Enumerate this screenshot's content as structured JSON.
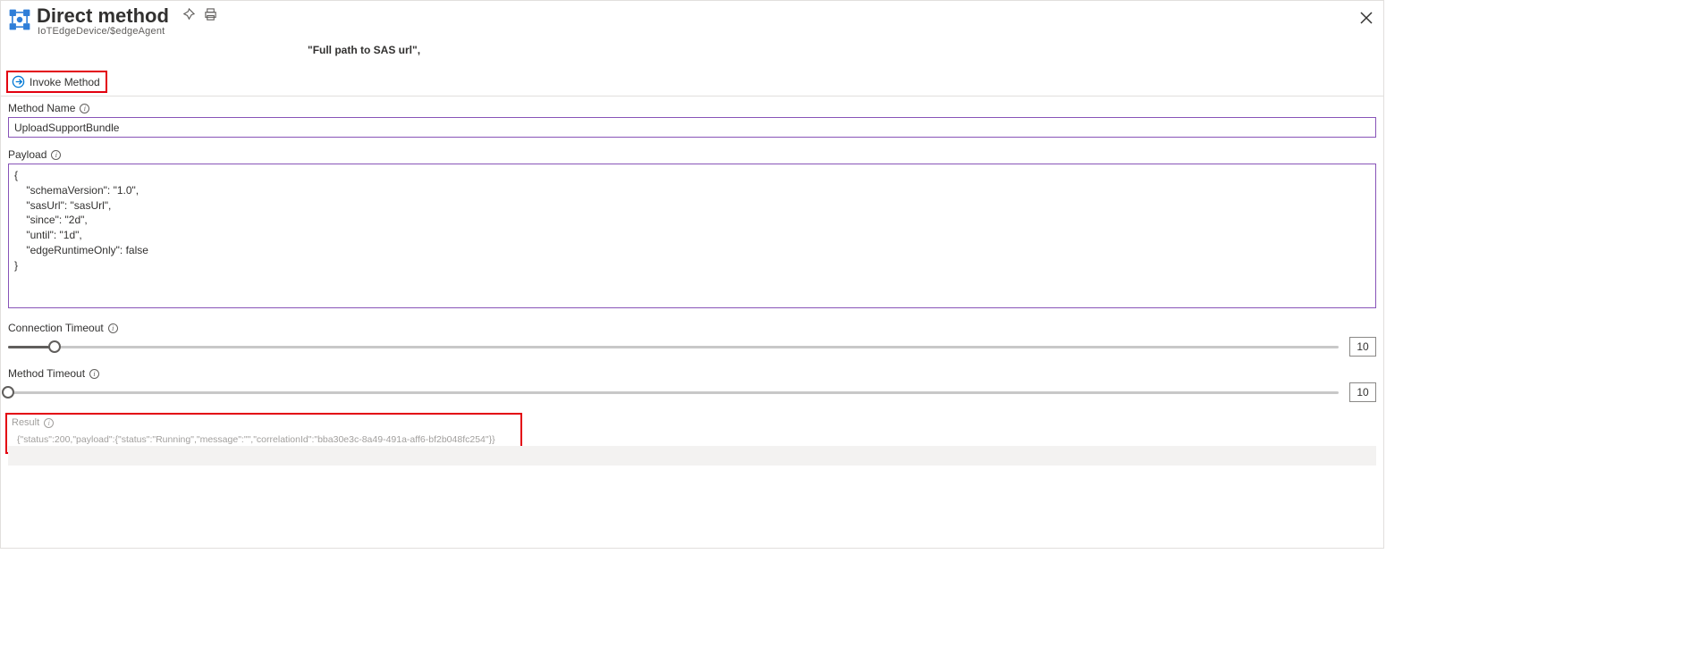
{
  "header": {
    "title": "Direct method",
    "subtitle": "IoTEdgeDevice/$edgeAgent"
  },
  "sas_text": "\"Full path to SAS url\",",
  "invoke": {
    "label": "Invoke Method"
  },
  "method_name": {
    "label": "Method Name",
    "value": "UploadSupportBundle"
  },
  "payload": {
    "label": "Payload",
    "value": "{\n    \"schemaVersion\": \"1.0\",\n    \"sasUrl\": \"sasUrl\",\n    \"since\": \"2d\",\n    \"until\": \"1d\",\n    \"edgeRuntimeOnly\": false\n}"
  },
  "connection_timeout": {
    "label": "Connection Timeout",
    "value": "10"
  },
  "method_timeout": {
    "label": "Method Timeout",
    "value": "10"
  },
  "result": {
    "label": "Result",
    "value": "{\"status\":200,\"payload\":{\"status\":\"Running\",\"message\":\"\",\"correlationId\":\"bba30e3c-8a49-491a-aff6-bf2b048fc254\"}}"
  }
}
